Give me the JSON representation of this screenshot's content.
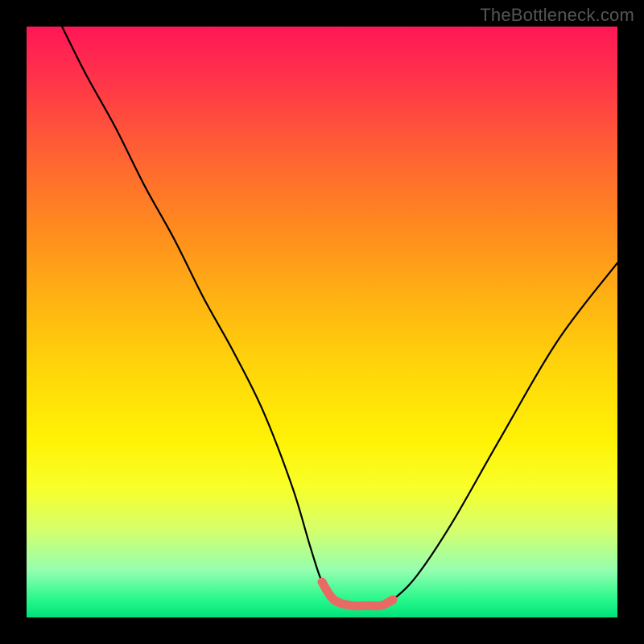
{
  "watermark": "TheBottleneck.com",
  "chart_data": {
    "type": "line",
    "title": "",
    "xlabel": "",
    "ylabel": "",
    "xlim": [
      0,
      100
    ],
    "ylim": [
      0,
      100
    ],
    "grid": false,
    "legend": false,
    "series": [
      {
        "name": "black-curve",
        "color": "#000000",
        "x": [
          6,
          10,
          15,
          20,
          25,
          30,
          35,
          40,
          45,
          48,
          50,
          52,
          55,
          58,
          60,
          62,
          66,
          72,
          80,
          90,
          100
        ],
        "y": [
          100,
          92,
          83,
          73,
          64,
          54,
          45,
          35,
          22,
          12,
          6,
          3,
          2,
          2,
          2,
          3,
          7,
          16,
          30,
          47,
          60
        ]
      },
      {
        "name": "red-floor-segment",
        "color": "#e96a64",
        "x": [
          50,
          52,
          55,
          58,
          60,
          62
        ],
        "y": [
          6,
          3,
          2,
          2,
          2,
          3
        ]
      }
    ],
    "gradient_stops": [
      {
        "pos": 0.0,
        "color": "#ff1756"
      },
      {
        "pos": 0.14,
        "color": "#ff4640"
      },
      {
        "pos": 0.34,
        "color": "#ff8a1f"
      },
      {
        "pos": 0.58,
        "color": "#ffd60a"
      },
      {
        "pos": 0.78,
        "color": "#f8ff2a"
      },
      {
        "pos": 0.92,
        "color": "#95ffb0"
      },
      {
        "pos": 1.0,
        "color": "#00e27a"
      }
    ]
  }
}
